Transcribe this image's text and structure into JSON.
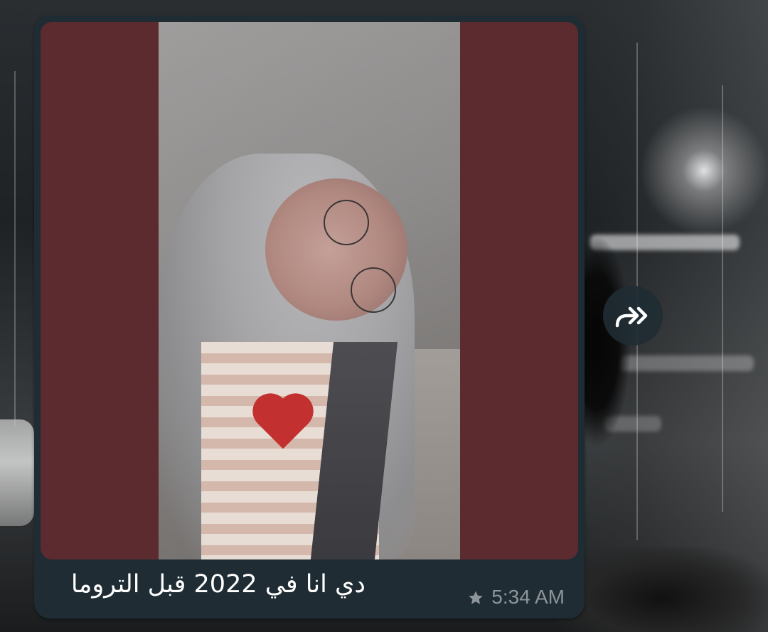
{
  "message": {
    "caption": "دي انا في 2022 قبل التروما",
    "time": "5:34 AM",
    "starred": true,
    "star_icon": "star-icon",
    "media_type": "image",
    "media_description_icon": "photo"
  },
  "actions": {
    "forward_icon": "forward-icon"
  },
  "colors": {
    "bubble_bg": "#1f2c34",
    "media_letterbox": "#5c2b30",
    "meta_text": "#8d9599",
    "caption_text": "#ffffff"
  }
}
